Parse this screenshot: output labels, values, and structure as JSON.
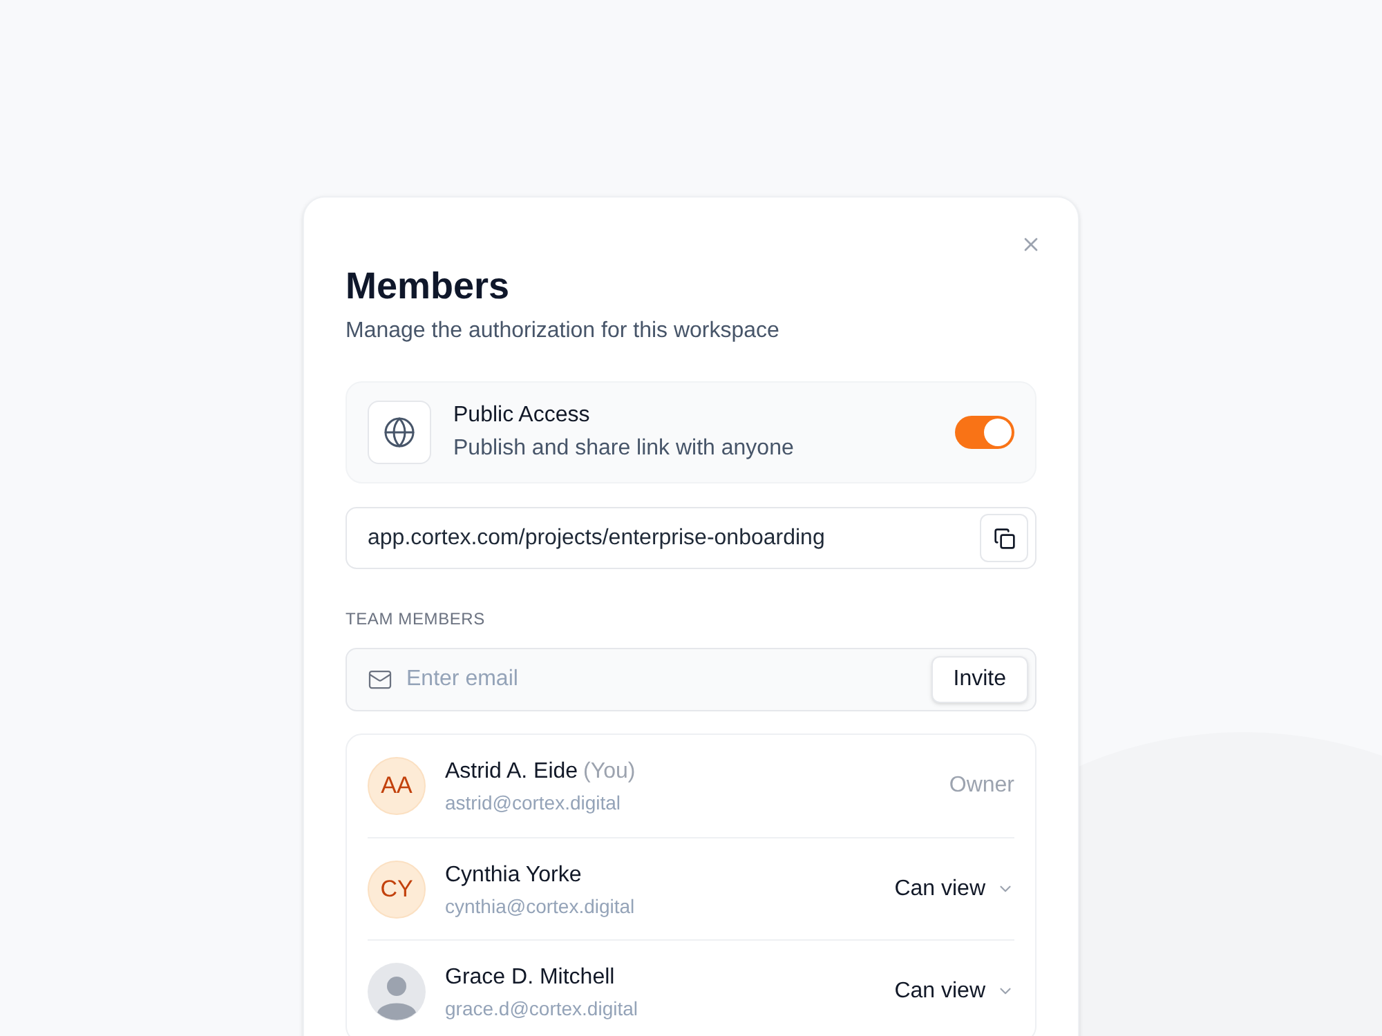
{
  "dialog": {
    "title": "Members",
    "subtitle": "Manage the authorization for this workspace"
  },
  "public_access": {
    "title": "Public Access",
    "description": "Publish and share link with anyone",
    "on": true
  },
  "share_link": {
    "value": "app.cortex.com/projects/enterprise-onboarding"
  },
  "team_section": {
    "heading": "TEAM MEMBERS",
    "invite_field": {
      "placeholder": "Enter email"
    },
    "invite_button": "Invite"
  },
  "members": [
    {
      "avatar": {
        "kind": "initials",
        "initials": "AA"
      },
      "name": "Astrid A. Eide",
      "tag": "(You)",
      "email": "astrid@cortex.digital",
      "role": {
        "kind": "static",
        "label": "Owner"
      }
    },
    {
      "avatar": {
        "kind": "initials",
        "initials": "CY"
      },
      "name": "Cynthia Yorke",
      "email": "cynthia@cortex.digital",
      "role": {
        "kind": "dropdown",
        "label": "Can view"
      }
    },
    {
      "avatar": {
        "kind": "photo"
      },
      "name": "Grace D. Mitchell",
      "email": "grace.d@cortex.digital",
      "role": {
        "kind": "dropdown",
        "label": "Can view"
      }
    }
  ]
}
